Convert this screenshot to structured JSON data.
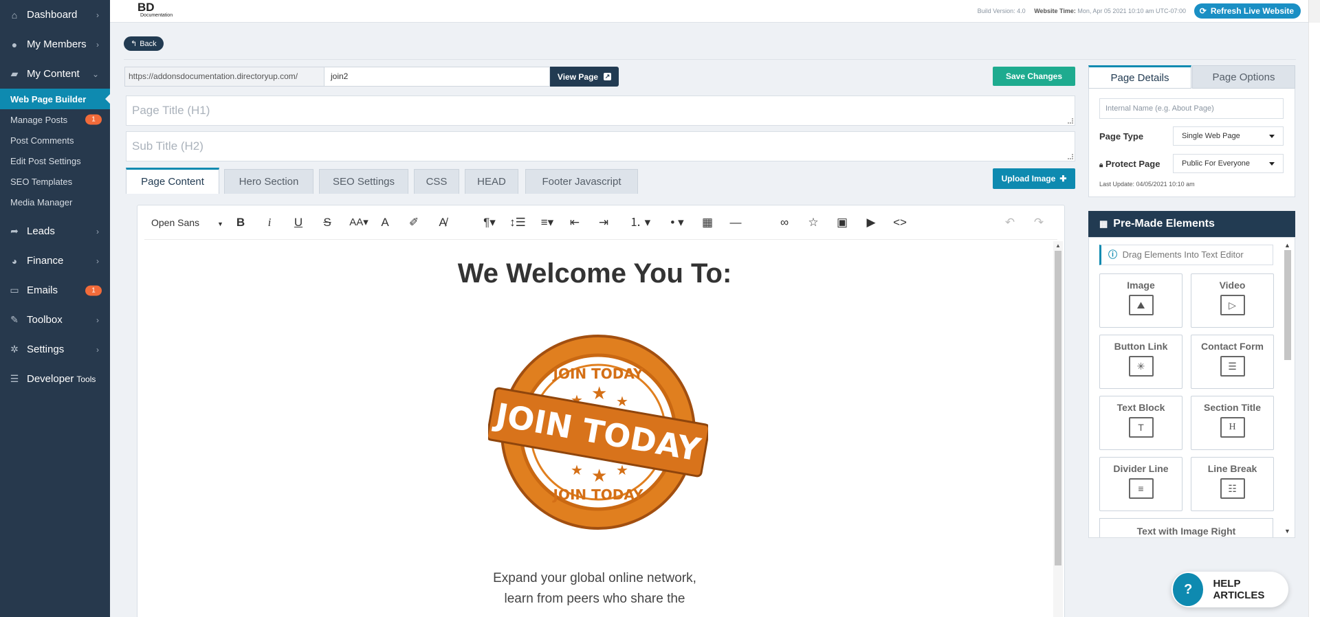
{
  "sidebar": {
    "items": [
      {
        "label": "Dashboard",
        "icon": "dashboard-icon"
      },
      {
        "label": "My Members",
        "icon": "members-icon"
      },
      {
        "label": "My Content",
        "icon": "folder-open-icon"
      }
    ],
    "sub_items": [
      {
        "label": "Web Page Builder",
        "active": true,
        "badge": ""
      },
      {
        "label": "Manage Posts",
        "badge": "1"
      },
      {
        "label": "Post Comments",
        "badge": ""
      },
      {
        "label": "Edit Post Settings",
        "badge": ""
      },
      {
        "label": "SEO Templates",
        "badge": ""
      },
      {
        "label": "Media Manager",
        "badge": ""
      }
    ],
    "items_bottom": [
      {
        "label": "Leads",
        "icon": "leads-icon"
      },
      {
        "label": "Finance",
        "icon": "finance-icon"
      },
      {
        "label": "Emails",
        "icon": "inbox-icon",
        "badge": "1"
      },
      {
        "label": "Toolbox",
        "icon": "wrench-icon"
      },
      {
        "label": "Settings",
        "icon": "gear-icon"
      },
      {
        "label": "Developer",
        "suffix": "Tools",
        "icon": "sliders-icon"
      }
    ]
  },
  "topbar": {
    "logo_text": "BD",
    "logo_sub": "Documentation",
    "build_label": "Build Version: 4.0",
    "time_label": "Website Time:",
    "time_value": "Mon, Apr 05 2021 10:10 am UTC-07:00",
    "refresh_label": "Refresh Live Website"
  },
  "back_label": "Back",
  "url": {
    "prefix": "https://addonsdocumentation.directoryup.com/",
    "slug": "join2",
    "view_label": "View Page"
  },
  "save_label": "Save Changes",
  "title_placeholder": "Page Title (H1)",
  "subtitle_placeholder": "Sub Title (H2)",
  "tabs": [
    "Page Content",
    "Hero Section",
    "SEO Settings",
    "CSS",
    "HEAD",
    "Footer Javascript"
  ],
  "upload_label": "Upload Image",
  "editor": {
    "font": "Open Sans",
    "headline": "We Welcome You To:",
    "stamp_text": "JOIN TODAY",
    "body_line1": "Expand your global online network,",
    "body_line2": "learn from peers who share the"
  },
  "right_panel": {
    "tabs": [
      "Page Details",
      "Page Options"
    ],
    "internal_name_placeholder": "Internal Name (e.g. About Page)",
    "page_type_label": "Page Type",
    "page_type_value": "Single Web Page",
    "protect_label": "Protect Page",
    "protect_value": "Public For Everyone",
    "last_update": "Last Update: 04/05/2021 10:10 am"
  },
  "premade": {
    "title": "Pre-Made Elements",
    "hint": "Drag Elements Into Text Editor",
    "elements": [
      "Image",
      "Video",
      "Button Link",
      "Contact Form",
      "Text Block",
      "Section Title",
      "Divider Line",
      "Line Break"
    ],
    "last": "Text with Image Right"
  },
  "help_label": "HELP ARTICLES",
  "colors": {
    "sidebar": "#27394d",
    "accent": "#0e8ab0",
    "save": "#1eab8f",
    "badge": "#f26b3a",
    "stamp": "#e07f1f"
  }
}
